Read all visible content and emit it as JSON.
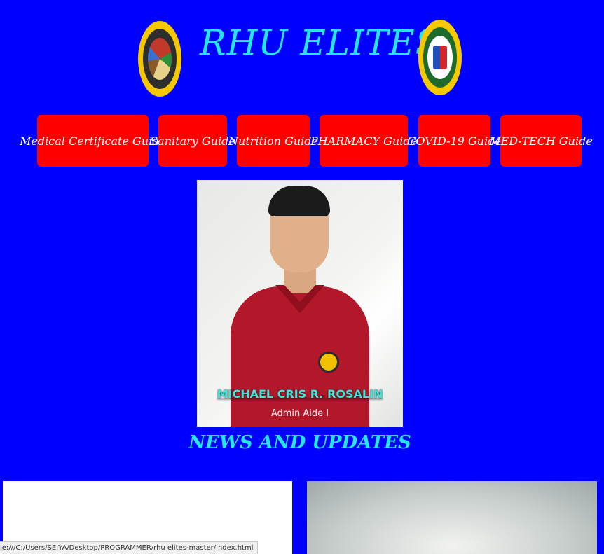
{
  "header": {
    "title": "RHU ELITES",
    "left_seal": "municipality-of-manaoag-seal",
    "right_seal": "department-of-health-seal"
  },
  "nav": {
    "items": [
      {
        "label": "Medical Certificate Guide"
      },
      {
        "label": "Sanitary Guide"
      },
      {
        "label": "Nutrition Guide"
      },
      {
        "label": "PHARMACY Guide"
      },
      {
        "label": "COVID-19 Guide"
      },
      {
        "label": "MED-TECH Guide"
      }
    ]
  },
  "profile": {
    "name": "MICHAEL CRIS R. ROSALIN",
    "role": "Admin Aide I"
  },
  "news": {
    "title": "NEWS AND UPDATES"
  },
  "status_bar": {
    "url": "le:///C:/Users/SEIYA/Desktop/PROGRAMMER/rhu elites-master/index.html"
  },
  "colors": {
    "background": "#0000ff",
    "title": "#24e6e6",
    "button": "#ff0000",
    "button_text": "#ffffff"
  }
}
